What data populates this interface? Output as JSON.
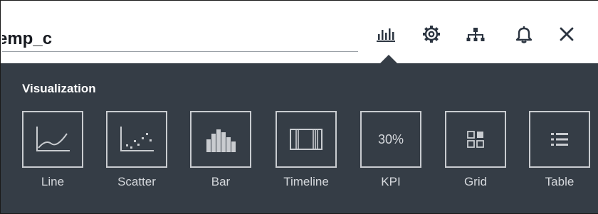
{
  "header": {
    "title_value": "temp_c",
    "tools": [
      {
        "name": "visualize",
        "icon": "bar-chart-icon"
      },
      {
        "name": "settings",
        "icon": "gear-icon"
      },
      {
        "name": "hierarchy",
        "icon": "hierarchy-icon"
      },
      {
        "name": "alerts",
        "icon": "bell-icon"
      },
      {
        "name": "close",
        "icon": "close-icon"
      }
    ]
  },
  "panel": {
    "title": "Visualization",
    "options": [
      {
        "label": "Line",
        "icon": "line-chart-icon"
      },
      {
        "label": "Scatter",
        "icon": "scatter-chart-icon"
      },
      {
        "label": "Bar",
        "icon": "bar-chart-icon"
      },
      {
        "label": "Timeline",
        "icon": "timeline-icon"
      },
      {
        "label": "KPI",
        "icon": "kpi-icon",
        "icon_text": "30%"
      },
      {
        "label": "Grid",
        "icon": "grid-icon"
      },
      {
        "label": "Table",
        "icon": "table-icon"
      }
    ]
  },
  "colors": {
    "panel_background": "#353d46",
    "icon_stroke": "#c9ccd0",
    "label_text": "#d5d8dc",
    "header_icon": "#2b3440"
  }
}
